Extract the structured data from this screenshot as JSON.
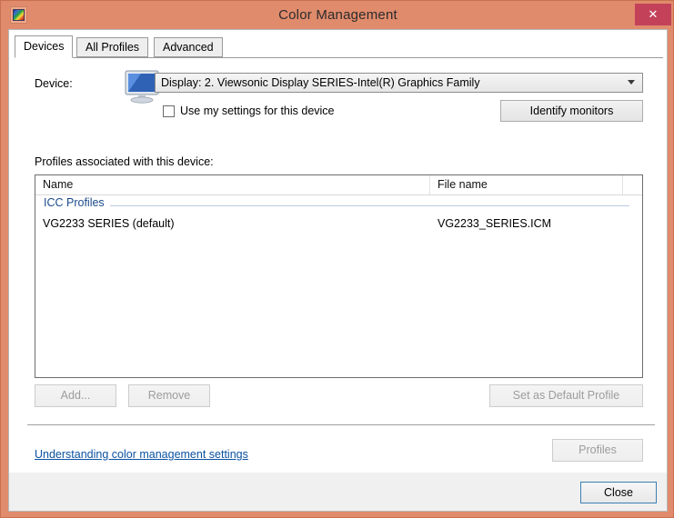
{
  "window": {
    "title": "Color Management",
    "icon": "color-management-icon",
    "close_label": "✕",
    "titlebar_color": "#e08b6c",
    "close_button_color": "#c3425a"
  },
  "tabs": [
    {
      "label": "Devices",
      "selected": true
    },
    {
      "label": "All Profiles",
      "selected": false
    },
    {
      "label": "Advanced",
      "selected": false
    }
  ],
  "device_section": {
    "label": "Device:",
    "icon": "display-monitor-icon",
    "selected_device": "Display: 2. Viewsonic Display SERIES-Intel(R) Graphics Family",
    "checkbox_label": "Use my settings for this device",
    "checkbox_checked": false,
    "identify_monitors_label": "Identify monitors"
  },
  "profiles_section": {
    "label": "Profiles associated with this device:",
    "columns": [
      "Name",
      "File name"
    ],
    "group_label": "ICC Profiles",
    "rows": [
      {
        "name": "VG2233 SERIES (default)",
        "file_name": "VG2233_SERIES.ICM"
      }
    ],
    "add_label": "Add...",
    "remove_label": "Remove",
    "set_default_label": "Set as Default Profile"
  },
  "footer": {
    "help_link": "Understanding color management settings",
    "profiles_label": "Profiles",
    "link_color": "#0b52a1"
  },
  "bottom_bar": {
    "close_label": "Close"
  }
}
